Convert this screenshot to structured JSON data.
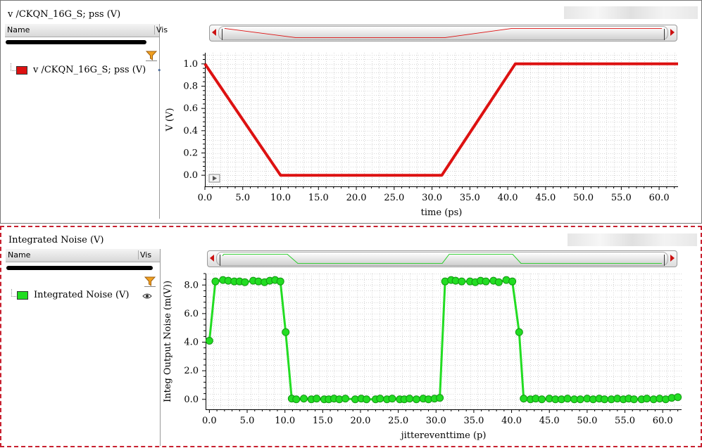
{
  "panel1": {
    "title": "v /CKQN_16G_S; pss (V)",
    "legend": {
      "col_name": "Name",
      "col_vis": "Vis",
      "item_label": "v /CKQN_16G_S; pss (V)",
      "item_color": "#dd1111"
    }
  },
  "panel2": {
    "title": "Integrated Noise (V)",
    "legend": {
      "col_name": "Name",
      "col_vis": "Vis",
      "item_label": "Integrated Noise (V)",
      "item_color": "#22dd22"
    }
  },
  "chart_data": [
    {
      "type": "line",
      "xlabel": "time (ps)",
      "ylabel": "V (V)",
      "xlim": [
        0,
        62.5
      ],
      "ylim": [
        -0.1,
        1.1
      ],
      "xticks": [
        "0.0",
        "5.0",
        "10.0",
        "15.0",
        "20.0",
        "25.0",
        "30.0",
        "35.0",
        "40.0",
        "45.0",
        "50.0",
        "55.0",
        "60.0"
      ],
      "yticks": [
        "0.0",
        "0.2",
        "0.4",
        "0.6",
        "0.8",
        "1.0"
      ],
      "grid": true,
      "series": [
        {
          "color": "#dd1111",
          "x": [
            0,
            10,
            31.3,
            41,
            62.5
          ],
          "y": [
            1.0,
            0.0,
            0.0,
            1.0,
            1.0
          ]
        }
      ]
    },
    {
      "type": "line",
      "xlabel": "jittereventtime (p)",
      "ylabel": "Integ Output Noise (m(V))",
      "xlim": [
        -0.5,
        62.5
      ],
      "ylim": [
        -0.7,
        8.8
      ],
      "xticks": [
        "0.0",
        "5.0",
        "10.0",
        "15.0",
        "20.0",
        "25.0",
        "30.0",
        "35.0",
        "40.0",
        "45.0",
        "50.0",
        "55.0",
        "60.0"
      ],
      "yticks": [
        "0.0",
        "2.0",
        "4.0",
        "6.0",
        "8.0"
      ],
      "grid": true,
      "markers": true,
      "series": [
        {
          "color": "#22dd22",
          "x": [
            0,
            0.8,
            1.8,
            2.5,
            3.3,
            4.0,
            4.7,
            5.8,
            6.5,
            7.3,
            8.0,
            8.7,
            9.4,
            10.1,
            10.9,
            11.5,
            12.5,
            13.5,
            14.2,
            15.2,
            15.8,
            16.5,
            17.2,
            18.0,
            19.3,
            20.1,
            20.8,
            22.0,
            22.6,
            23.5,
            24.2,
            25.2,
            25.8,
            26.5,
            27.4,
            28.3,
            29.0,
            29.8,
            30.5,
            31.2,
            32.0,
            32.6,
            33.4,
            34.5,
            35.2,
            35.9,
            36.6,
            37.6,
            38.3,
            39.3,
            40.1,
            41.0,
            41.6,
            42.5,
            43.2,
            44.0,
            45.0,
            45.8,
            46.6,
            47.4,
            48.3,
            49.1,
            50.0,
            50.8,
            51.6,
            52.3,
            53.2,
            54.0,
            54.8,
            55.5,
            56.2,
            57.2,
            57.9,
            58.8,
            59.6,
            60.4,
            61.2,
            62.0
          ],
          "y": [
            4.1,
            8.25,
            8.35,
            8.3,
            8.25,
            8.25,
            8.2,
            8.3,
            8.25,
            8.2,
            8.3,
            8.35,
            8.25,
            4.7,
            0.05,
            0.0,
            0.05,
            0.0,
            0.05,
            0.0,
            0.0,
            0.05,
            0.0,
            0.05,
            0.0,
            0.05,
            0.0,
            0.0,
            0.05,
            0.0,
            0.05,
            0.0,
            0.0,
            0.05,
            0.0,
            0.05,
            0.0,
            0.05,
            0.1,
            8.25,
            8.35,
            8.3,
            8.25,
            8.25,
            8.2,
            8.3,
            8.25,
            8.3,
            8.2,
            8.35,
            8.25,
            4.7,
            0.05,
            0.0,
            0.05,
            0.0,
            0.05,
            0.0,
            0.0,
            0.05,
            0.0,
            0.0,
            0.05,
            0.0,
            0.05,
            0.0,
            0.0,
            0.05,
            0.0,
            0.05,
            0.0,
            0.0,
            0.05,
            0.0,
            0.05,
            0.0,
            0.1,
            0.15
          ]
        }
      ]
    }
  ]
}
